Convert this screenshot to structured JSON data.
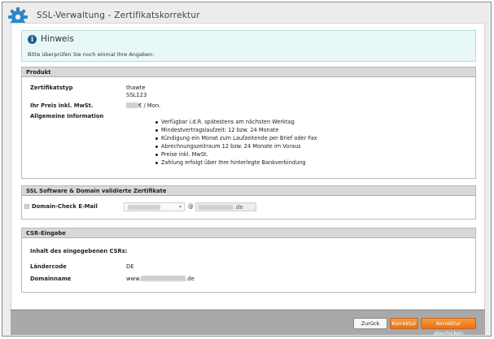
{
  "window": {
    "title": "SSL-Verwaltung - Zertifikatskorrektur"
  },
  "hint": {
    "title": "Hinweis",
    "text": "Bitte überprüfen Sie noch einmal Ihre Angaben:"
  },
  "product": {
    "header": "Produkt",
    "type_label": "Zertifikatstyp",
    "type_value_1": "thawte",
    "type_value_2": "SSL123",
    "price_label": "Ihr Preis inkl. MwSt.",
    "price_suffix": "€ / Mon.",
    "info_label": "Allgemeine Information",
    "info_items": [
      "Verfügbar i.d.R. spätestens am nächsten Werktag",
      "Mindestvertragslaufzeit: 12 bzw. 24 Monate",
      "Kündigung ein Monat zum Laufzeitende per Brief oder Fax",
      "Abrechnungszeitraum 12 bzw. 24 Monate im Voraus",
      "Preise inkl. MwSt.",
      "Zahlung erfolgt über Ihre hinterlegte Bankverbindung"
    ]
  },
  "ssl": {
    "header": "SSL Software & Domain validierte Zertifikate",
    "email_label": "Domain-Check E-Mail",
    "at_sign": "@",
    "domain_suffix": ".de"
  },
  "csr": {
    "header": "CSR-Eingabe",
    "content_label": "Inhalt des eingegebenen CSRs:",
    "country_label": "Ländercode",
    "country_value": "DE",
    "domain_label": "Domainname",
    "domain_prefix": "www.",
    "domain_suffix": ".de"
  },
  "footer": {
    "back_label": "Zurück",
    "correction_label": "Korrektur",
    "submit_label": "Korrektur abschicken"
  },
  "colors": {
    "accent": "#ee8224",
    "hint_bg": "#e8f8f8",
    "icon_blue": "#1f5d88",
    "footer_bg": "#a9a9a9"
  }
}
